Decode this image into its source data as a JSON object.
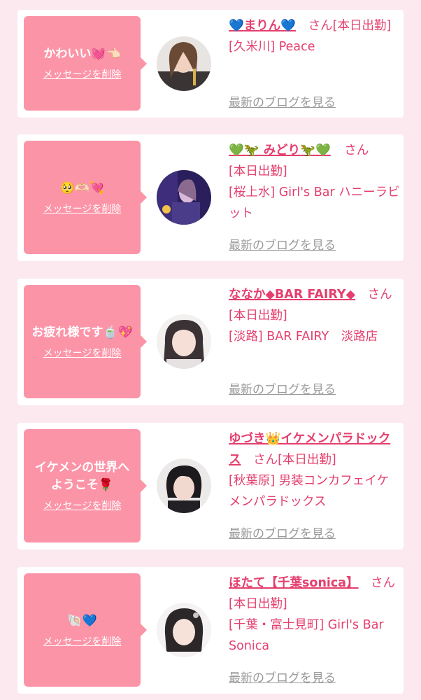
{
  "entries": [
    {
      "message": "かわいい💓👈🏻",
      "delete_label": "メッセージを削除",
      "name_pre": "💙",
      "name": "まりん",
      "name_post": "💙",
      "san": "さん",
      "status": "[本日出勤]",
      "shop": "[久米川] Peace",
      "blog_label": "最新のブログを見る",
      "avatar_icon": "avatar-photo"
    },
    {
      "message": "🥺🫶🏻💘",
      "delete_label": "メッセージを削除",
      "name_pre": "💚🦖",
      "name": "みどり",
      "name_post": "🦖💚",
      "san": "さん",
      "status": "[本日出勤]",
      "shop": "[桜上水] Girl's Bar ハニーラビット",
      "blog_label": "最新のブログを見る",
      "avatar_icon": "avatar-photo"
    },
    {
      "message": "お疲れ様です🍵💖",
      "delete_label": "メッセージを削除",
      "name_pre": "",
      "name": "ななか◆BAR FAIRY◆",
      "name_post": "",
      "san": "さん",
      "status": "[本日出勤]",
      "shop": "[淡路] BAR FAIRY　淡路店",
      "blog_label": "最新のブログを見る",
      "avatar_icon": "avatar-photo"
    },
    {
      "message": "イケメンの世界へようこそ🌹",
      "delete_label": "メッセージを削除",
      "name_pre": "",
      "name": "ゆづき👑イケメンパラドックス",
      "name_post": "",
      "san": "さん",
      "status": "[本日出勤]",
      "shop": "[秋葉原] 男装コンカフェイケメンパラドックス",
      "blog_label": "最新のブログを見る",
      "avatar_icon": "avatar-photo"
    },
    {
      "message": "🐚💙",
      "delete_label": "メッセージを削除",
      "name_pre": "",
      "name": "ほたて【千葉sonica】",
      "name_post": "",
      "san": "さん",
      "status": "[本日出勤]",
      "shop": "[千葉・富士見町] Girl's Bar Sonica",
      "blog_label": "最新のブログを見る",
      "avatar_icon": "avatar-photo"
    }
  ]
}
